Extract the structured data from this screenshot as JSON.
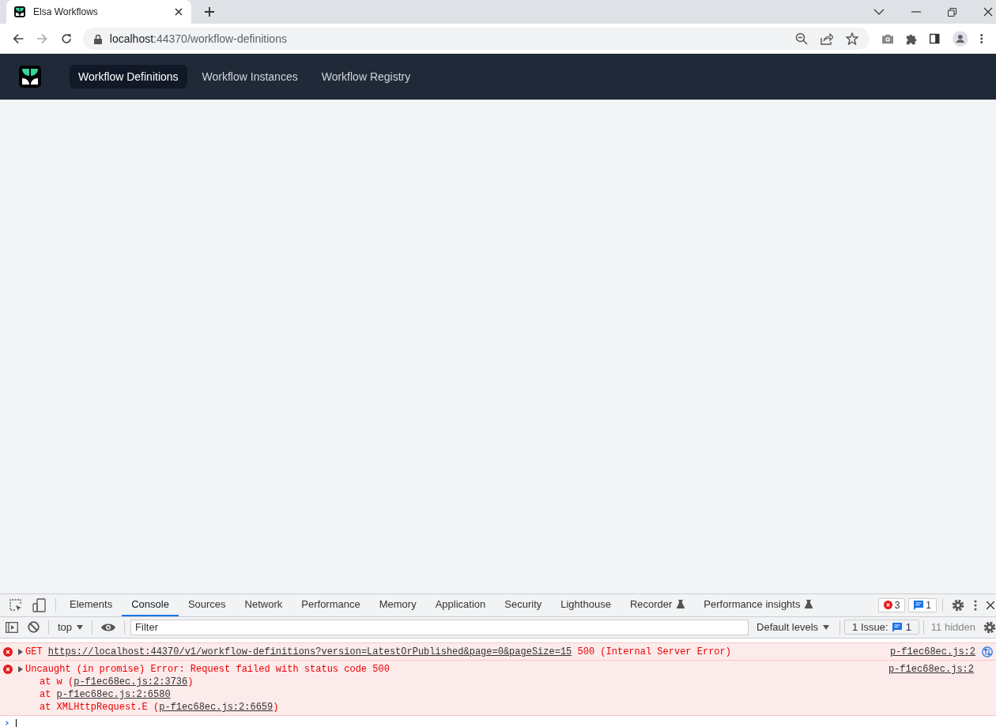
{
  "browser": {
    "tab_title": "Elsa Workflows",
    "url_host": "localhost",
    "url_rest": ":44370/workflow-definitions"
  },
  "app_nav": {
    "items": [
      {
        "label": "Workflow Definitions",
        "selected": true
      },
      {
        "label": "Workflow Instances",
        "selected": false
      },
      {
        "label": "Workflow Registry",
        "selected": false
      }
    ]
  },
  "devtools": {
    "tabs": [
      {
        "label": "Elements",
        "selected": false,
        "experimental": false
      },
      {
        "label": "Console",
        "selected": true,
        "experimental": false
      },
      {
        "label": "Sources",
        "selected": false,
        "experimental": false
      },
      {
        "label": "Network",
        "selected": false,
        "experimental": false
      },
      {
        "label": "Performance",
        "selected": false,
        "experimental": false
      },
      {
        "label": "Memory",
        "selected": false,
        "experimental": false
      },
      {
        "label": "Application",
        "selected": false,
        "experimental": false
      },
      {
        "label": "Security",
        "selected": false,
        "experimental": false
      },
      {
        "label": "Lighthouse",
        "selected": false,
        "experimental": false
      },
      {
        "label": "Recorder",
        "selected": false,
        "experimental": true
      },
      {
        "label": "Performance insights",
        "selected": false,
        "experimental": true
      }
    ],
    "error_count": "3",
    "message_count": "1",
    "console_toolbar": {
      "context": "top",
      "filter_placeholder": "Filter",
      "levels": "Default levels",
      "issues_label": "1 Issue:",
      "issues_count": "1",
      "hidden": "11 hidden"
    },
    "messages": [
      {
        "kind": "network",
        "method": "GET",
        "url": "https://localhost:44370/v1/workflow-definitions?version=LatestOrPublished&page=0&pageSize=15",
        "status": "500 (Internal Server Error)",
        "source": "p-f1ec68ec.js:2"
      },
      {
        "kind": "exception",
        "text": "Uncaught (in promise) Error: Request failed with status code 500",
        "source": "p-f1ec68ec.js:2",
        "stack": [
          {
            "before": "at w (",
            "link": "p-f1ec68ec.js:2:3736",
            "after": ")"
          },
          {
            "before": "at ",
            "link": "p-f1ec68ec.js:2:6580"
          },
          {
            "before": "at XMLHttpRequest.E (",
            "link": "p-f1ec68ec.js:2:6659",
            "after": ")"
          }
        ]
      }
    ]
  }
}
